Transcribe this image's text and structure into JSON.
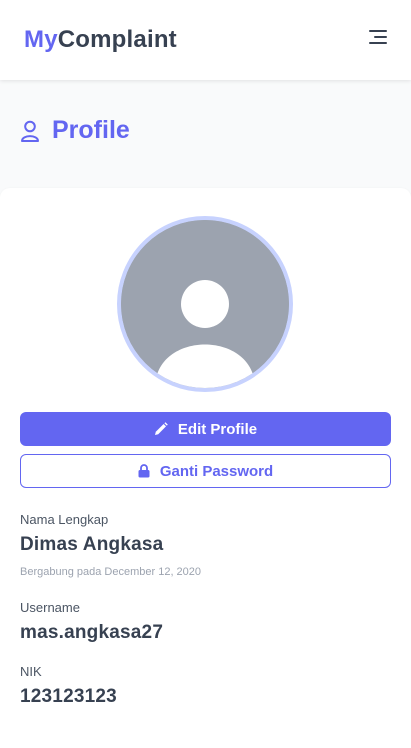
{
  "navbar": {
    "brand_part1": "My",
    "brand_part2": "Complaint",
    "menu_icon": "menu-icon"
  },
  "header": {
    "icon": "user-icon",
    "title": "Profile"
  },
  "profile": {
    "avatar_icon": "user-avatar-icon",
    "edit_button_label": "Edit Profile",
    "edit_icon": "pencil-icon",
    "password_button_label": "Ganti Password",
    "password_icon": "lock-icon",
    "fields": {
      "fullname_label": "Nama Lengkap",
      "fullname_value": "Dimas Angkasa",
      "joined_text": "Bergabung pada December 12, 2020",
      "username_label": "Username",
      "username_value": "mas.angkasa27",
      "nik_label": "NIK",
      "nik_value": "123123123"
    }
  },
  "colors": {
    "accent": "#6366f1",
    "avatar_ring": "#c7d2fe",
    "avatar_bg": "#9ca3af"
  }
}
